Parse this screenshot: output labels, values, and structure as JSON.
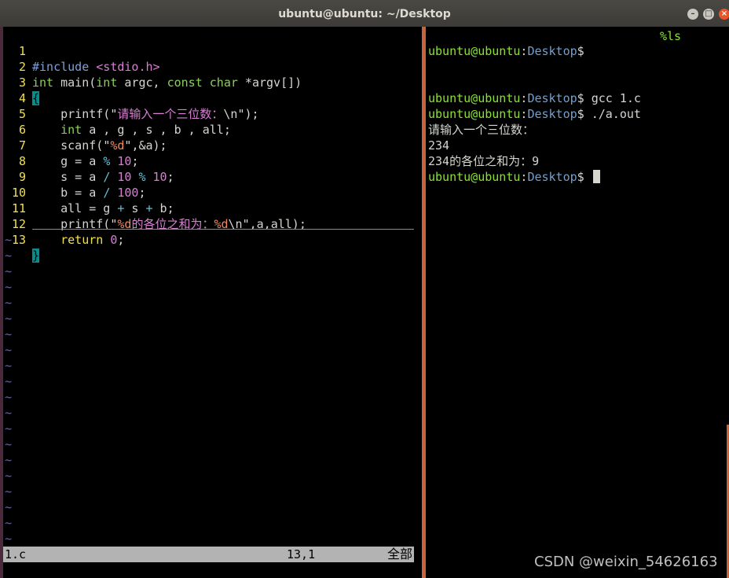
{
  "window": {
    "title": "ubuntu@ubuntu: ~/Desktop",
    "buttons": {
      "minimize": "–",
      "maximize": "□",
      "close": "×"
    }
  },
  "editor": {
    "lines": [
      {
        "n": "1"
      },
      {
        "n": "2"
      },
      {
        "n": "3"
      },
      {
        "n": "4"
      },
      {
        "n": "5"
      },
      {
        "n": "6"
      },
      {
        "n": "7"
      },
      {
        "n": "8"
      },
      {
        "n": "9"
      },
      {
        "n": "10"
      },
      {
        "n": "11"
      },
      {
        "n": "12"
      },
      {
        "n": "13"
      }
    ],
    "code": {
      "l1": {
        "pre": "#include",
        "inc": "<stdio.h>"
      },
      "l2": {
        "t1": "int",
        "fn": " main(",
        "t2": "int",
        "a1": " argc, ",
        "t3": "const",
        "sp": " ",
        "t4": "char",
        "a2": " *argv[])"
      },
      "l3": {
        "brace": "{"
      },
      "l4": {
        "fn": "printf(",
        "q1": "\"",
        "str": "请输入一个三位数：",
        "esc": "\\n",
        "q2": "\"",
        "end": ");"
      },
      "l5": {
        "t": "int",
        "rest": " a , g , s , b , all;"
      },
      "l6": {
        "fn": "scanf(",
        "q1": "\"",
        "fmt": "%d",
        "q2": "\"",
        "rest": ",&a);"
      },
      "l7": {
        "lhs": "g = a ",
        "op": "%",
        "sp": " ",
        "num": "10",
        "end": ";"
      },
      "l8": {
        "lhs": "s = a ",
        "op1": "/",
        "sp1": " ",
        "num1": "10",
        "sp2": " ",
        "op2": "%",
        "sp3": " ",
        "num2": "10",
        "end": ";"
      },
      "l9": {
        "lhs": "b = a ",
        "op": "/",
        "sp": " ",
        "num": "100",
        "end": ";"
      },
      "l10": {
        "lhs": "all = g ",
        "op1": "+",
        "mid": " s ",
        "op2": "+",
        "rhs": " b;"
      },
      "l11": {
        "fn": "printf(",
        "q1": "\"",
        "fmt1": "%d",
        "str": "的各位之和为：",
        "fmt2": "%d",
        "esc": "\\n",
        "q2": "\"",
        "rest": ",a,all);"
      },
      "l12": {
        "kw": "return",
        "sp": " ",
        "num": "0",
        "end": ";"
      },
      "l13": {
        "brace": "}"
      }
    },
    "tilde": "~",
    "status": {
      "file": "1.c",
      "position": "13,1",
      "percent": "全部"
    }
  },
  "terminal": {
    "top_right": "%ls",
    "user": "ubuntu@ubuntu",
    "sep": ":",
    "path": "Desktop",
    "prompt_end": "$",
    "cmd1": " gcc 1.c",
    "cmd2": " ./a.out",
    "cmd3": " ",
    "out1": "请输入一个三位数：",
    "out2": "234",
    "out3": "234的各位之和为：9"
  },
  "watermark": "CSDN @weixin_54626163"
}
